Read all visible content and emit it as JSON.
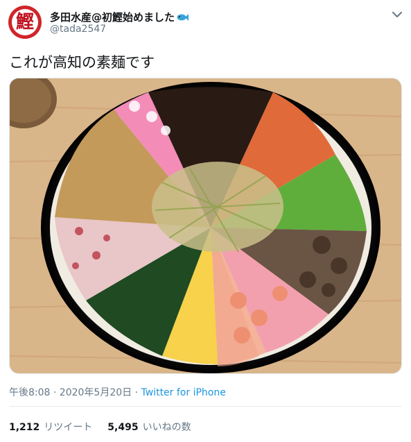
{
  "author": {
    "avatar_glyph": "鰹",
    "display_name": "多田水産@初鰹始めました",
    "handle": "@tada2547",
    "avatar_color": "#d0252a"
  },
  "tweet": {
    "text": "これが高知の素麺です"
  },
  "meta": {
    "time": "午後8:08 · 2020年5月20日 · ",
    "source": "Twitter for iPhone"
  },
  "stats": {
    "retweets_count": "1,212",
    "retweets_label": "リツイート",
    "likes_count": "5,495",
    "likes_label": "いいねの数"
  },
  "icons": {
    "fish": "fish-icon",
    "chevron": "chevron-down-icon"
  },
  "colors": {
    "link": "#1b95e0",
    "secondary_text": "#657786",
    "primary_text": "#14171a"
  }
}
